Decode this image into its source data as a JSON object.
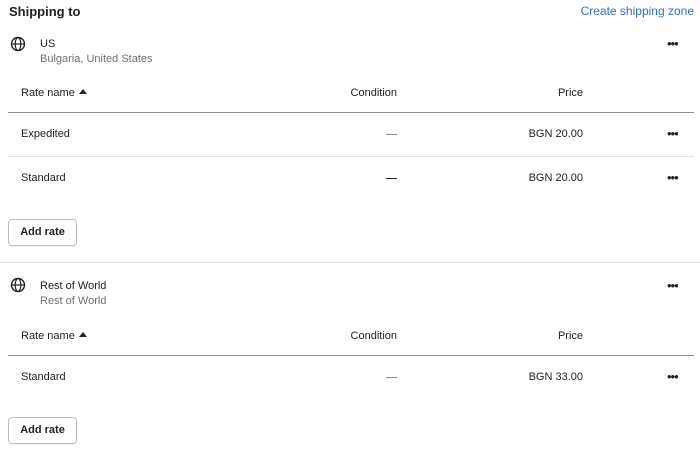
{
  "header": {
    "title": "Shipping to",
    "create_link": "Create shipping zone"
  },
  "columns": {
    "rate_name": "Rate name",
    "condition": "Condition",
    "price": "Price"
  },
  "zones": [
    {
      "icon": "globe-icon",
      "name": "US",
      "countries": "Bulgaria, United States",
      "rates": [
        {
          "name": "Expedited",
          "condition": "—",
          "price": "BGN 20.00"
        },
        {
          "name": "Standard",
          "condition": "—",
          "price": "BGN 20.00"
        }
      ],
      "add_rate_label": "Add rate"
    },
    {
      "icon": "globe-icon",
      "name": "Rest of World",
      "countries": "Rest of World",
      "rates": [
        {
          "name": "Standard",
          "condition": "—",
          "price": "BGN 33.00"
        }
      ],
      "add_rate_label": "Add rate"
    }
  ],
  "more_label": "•••",
  "colors": {
    "link": "#2c6ecb",
    "text": "#202223",
    "subdued": "#6d7175",
    "divider": "#e1e3e5"
  }
}
